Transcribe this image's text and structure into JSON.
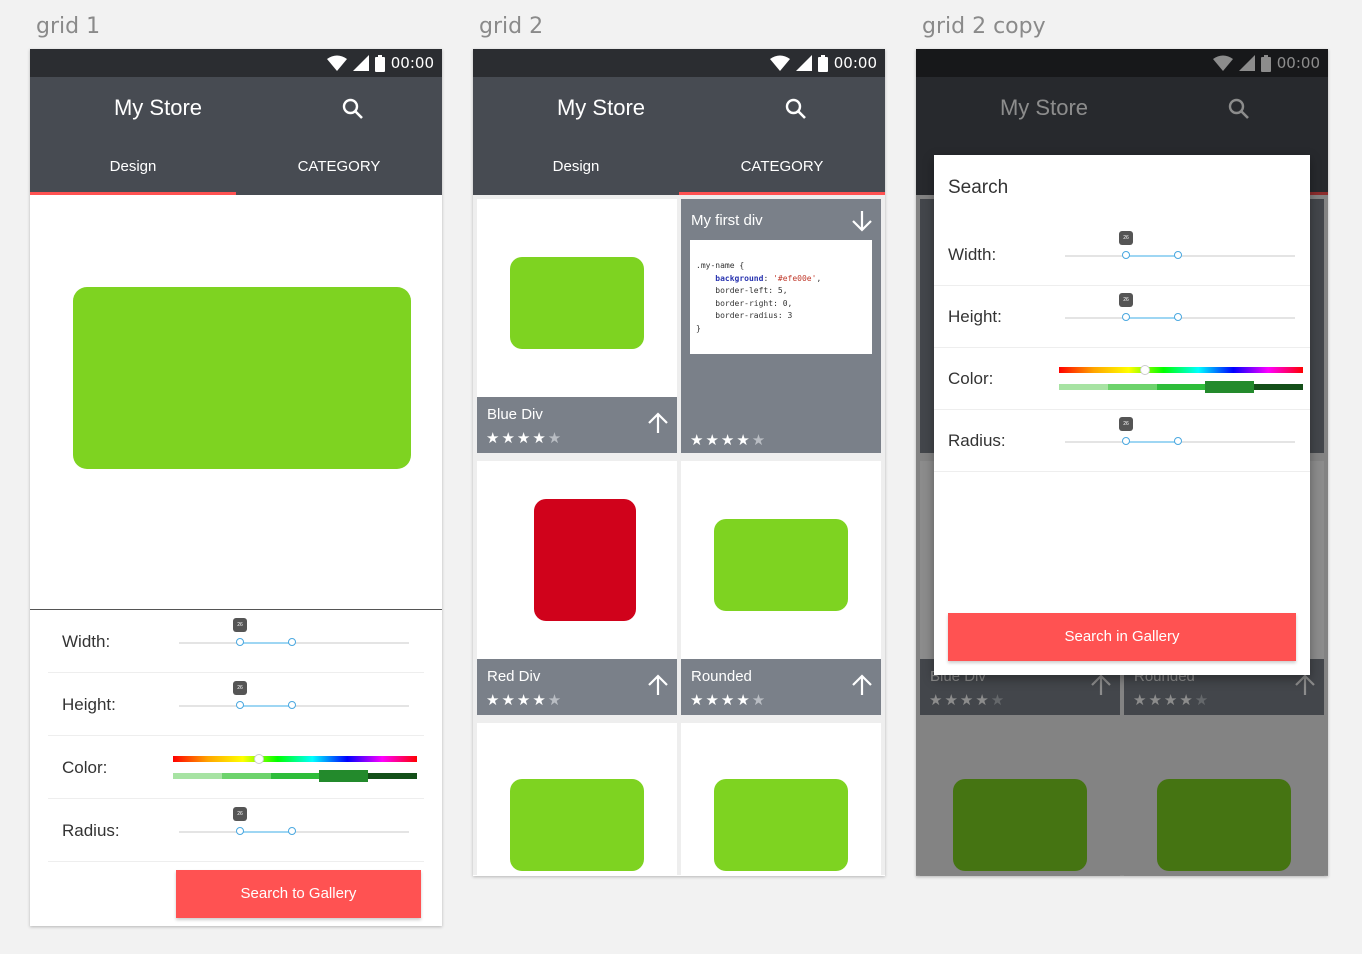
{
  "artboards": [
    "grid 1",
    "grid 2",
    "grid 2 copy"
  ],
  "status": {
    "time": "00:00"
  },
  "app": {
    "title": "My Store",
    "tabs": [
      "Design",
      "CATEGORY"
    ]
  },
  "controls": {
    "width_label": "Width:",
    "height_label": "Height:",
    "color_label": "Color:",
    "radius_label": "Radius:",
    "slider_value": "26"
  },
  "grid1": {
    "button": "Search to Gallery"
  },
  "grid2": {
    "cards": [
      {
        "title": "Blue Div",
        "rating": 4
      },
      {
        "title": "My first div",
        "rating": 4
      },
      {
        "title": "Red Div",
        "rating": 4
      },
      {
        "title": "Rounded",
        "rating": 4
      }
    ],
    "code": {
      "line1": ".my-name {",
      "line2_prop": "background",
      "line2_val": "'#efe00e'",
      "line3": "border-left: 5,",
      "line4": "border-right: 0,",
      "line5": "border-radius: 3",
      "line6": "}"
    }
  },
  "dialog": {
    "title": "Search",
    "button": "Search in Gallery"
  },
  "colors": {
    "primary": "#474b52",
    "status": "#2b2d31",
    "accent": "#ff5252",
    "green": "#7ed321",
    "red": "#d0021b",
    "card_footer": "#7a8089"
  }
}
